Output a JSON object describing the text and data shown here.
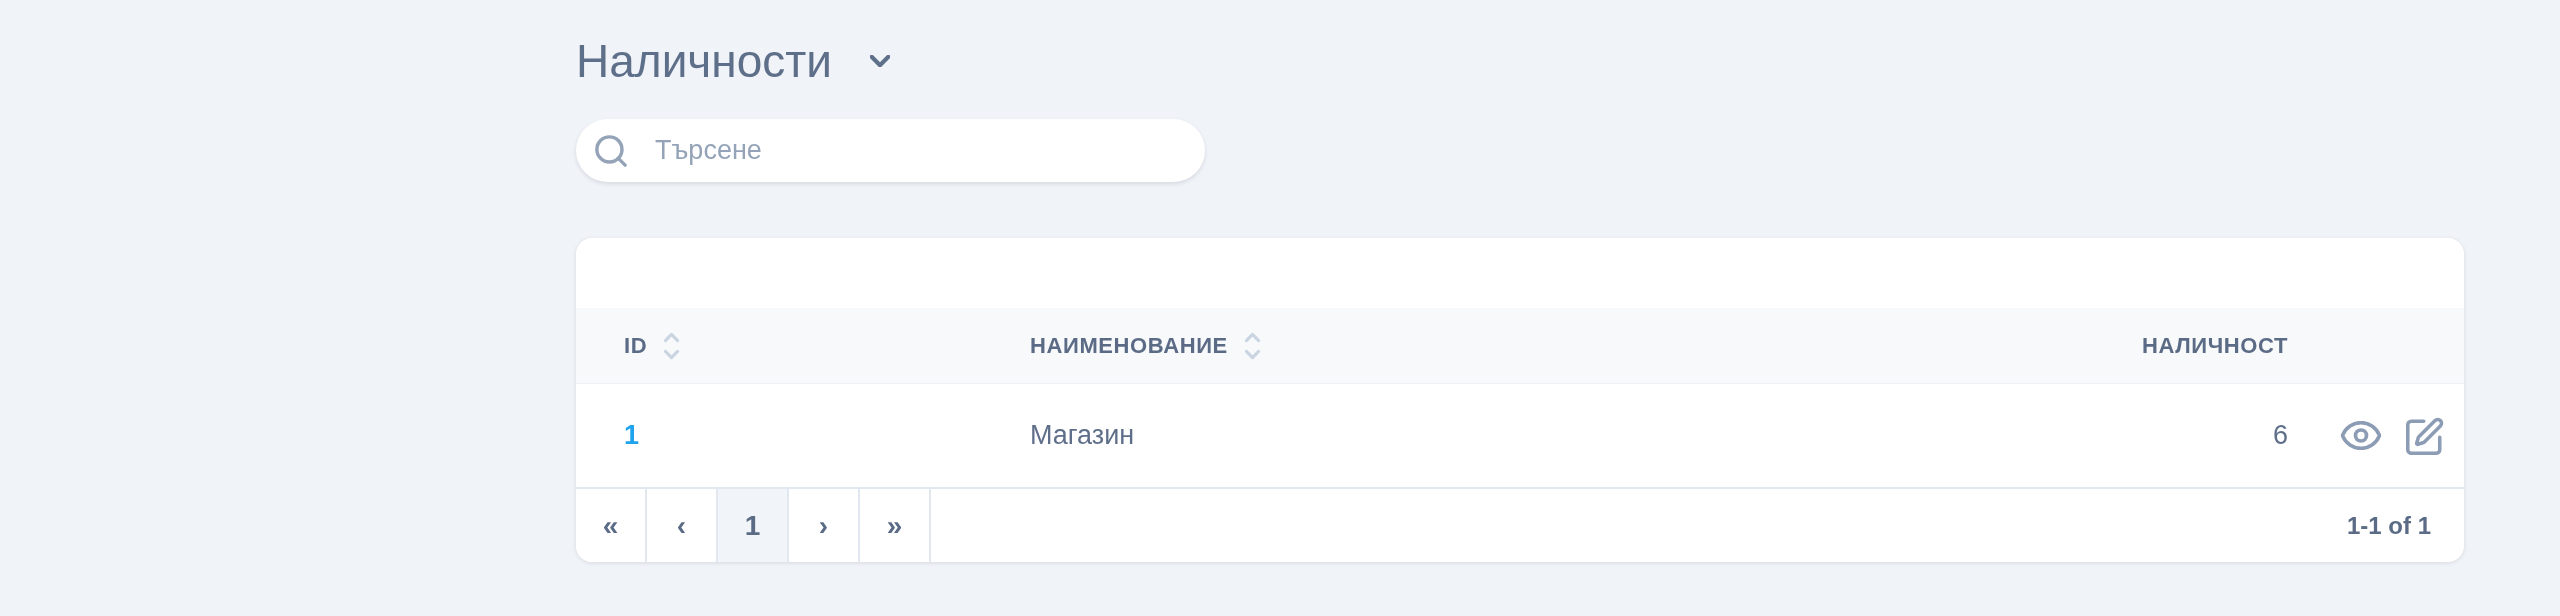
{
  "page": {
    "title": "Наличности"
  },
  "search": {
    "placeholder": "Търсене"
  },
  "table": {
    "columns": [
      {
        "label": "ID",
        "kind": "text",
        "sortable": true
      },
      {
        "label": "НАИМЕНОВАНИЕ",
        "kind": "text",
        "sortable": true
      },
      {
        "label": "НАЛИЧНОСТ",
        "kind": "number",
        "sortable": false
      }
    ],
    "rows": [
      {
        "id": "1",
        "name": "Магазин",
        "quantity": "6"
      }
    ],
    "pagination": {
      "pages": [
        {
          "label": "«",
          "selected": false
        },
        {
          "label": "‹",
          "selected": false
        },
        {
          "label": "1",
          "selected": true
        },
        {
          "label": "›",
          "selected": false
        },
        {
          "label": "»",
          "selected": false
        }
      ],
      "summary": "1-1 of 1"
    }
  }
}
